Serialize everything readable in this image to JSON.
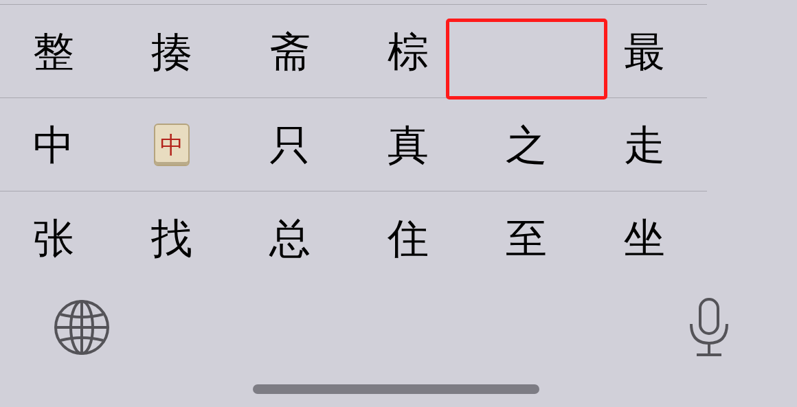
{
  "candidates": [
    [
      {
        "kind": "char",
        "text": "整",
        "highlighted": false
      },
      {
        "kind": "char",
        "text": "揍",
        "highlighted": false
      },
      {
        "kind": "char",
        "text": "斋",
        "highlighted": false
      },
      {
        "kind": "char",
        "text": "棕",
        "highlighted": false
      },
      {
        "kind": "blank",
        "highlighted": true
      },
      {
        "kind": "char",
        "text": "最",
        "highlighted": false
      }
    ],
    [
      {
        "kind": "char",
        "text": "中",
        "highlighted": false
      },
      {
        "kind": "tile",
        "text": "中",
        "highlighted": false
      },
      {
        "kind": "char",
        "text": "只",
        "highlighted": false
      },
      {
        "kind": "char",
        "text": "真",
        "highlighted": false
      },
      {
        "kind": "char",
        "text": "之",
        "highlighted": false
      },
      {
        "kind": "char",
        "text": "走",
        "highlighted": false
      }
    ],
    [
      {
        "kind": "char",
        "text": "张",
        "highlighted": false
      },
      {
        "kind": "char",
        "text": "找",
        "highlighted": false
      },
      {
        "kind": "char",
        "text": "总",
        "highlighted": false
      },
      {
        "kind": "char",
        "text": "住",
        "highlighted": false
      },
      {
        "kind": "char",
        "text": "至",
        "highlighted": false
      },
      {
        "kind": "char",
        "text": "坐",
        "highlighted": false
      }
    ]
  ]
}
